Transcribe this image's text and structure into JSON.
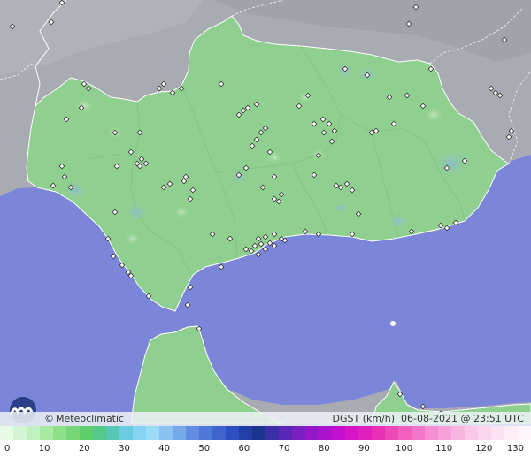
{
  "map": {
    "brand": "Meteoclimatic",
    "copyright_symbol": "©",
    "variable": "DGST (km/h)",
    "date": "06-08-2021",
    "at_symbol": "@",
    "time": "23:51 UTC",
    "colors": {
      "sea": "#7b86d8",
      "land_outside": "#a9abb2",
      "region_fill": "#8fcf8f",
      "coast_line": "#ffffff",
      "station": "#ffffff"
    }
  },
  "legend": {
    "ticks": [
      "0",
      "10",
      "20",
      "30",
      "40",
      "50",
      "60",
      "70",
      "80",
      "90",
      "100",
      "110",
      "120",
      "130"
    ],
    "min": 0,
    "max": 130,
    "colors": [
      "#e6fae6",
      "#d4f5d4",
      "#bff0bf",
      "#a8ea9f",
      "#8fe08a",
      "#76d678",
      "#5fcf6c",
      "#55c98a",
      "#57c6b4",
      "#6bcbe0",
      "#86d4f4",
      "#9bdcf7",
      "#8ac2f1",
      "#76a9ea",
      "#618ee2",
      "#4f78d9",
      "#3f64cd",
      "#2e4fbf",
      "#223fa7",
      "#1b358f",
      "#3b2fa8",
      "#5a27b6",
      "#7a1fc2",
      "#9417c9",
      "#ad12cf",
      "#c40fd0",
      "#d615c9",
      "#e01fbf",
      "#e830b6",
      "#ee47b7",
      "#f25fbf",
      "#f476c9",
      "#f68cd2",
      "#f7a1da",
      "#f8b5e1",
      "#f9c7e8",
      "#fad6ee",
      "#fbe2f3",
      "#fcedf7",
      "#fdf5fb"
    ]
  }
}
